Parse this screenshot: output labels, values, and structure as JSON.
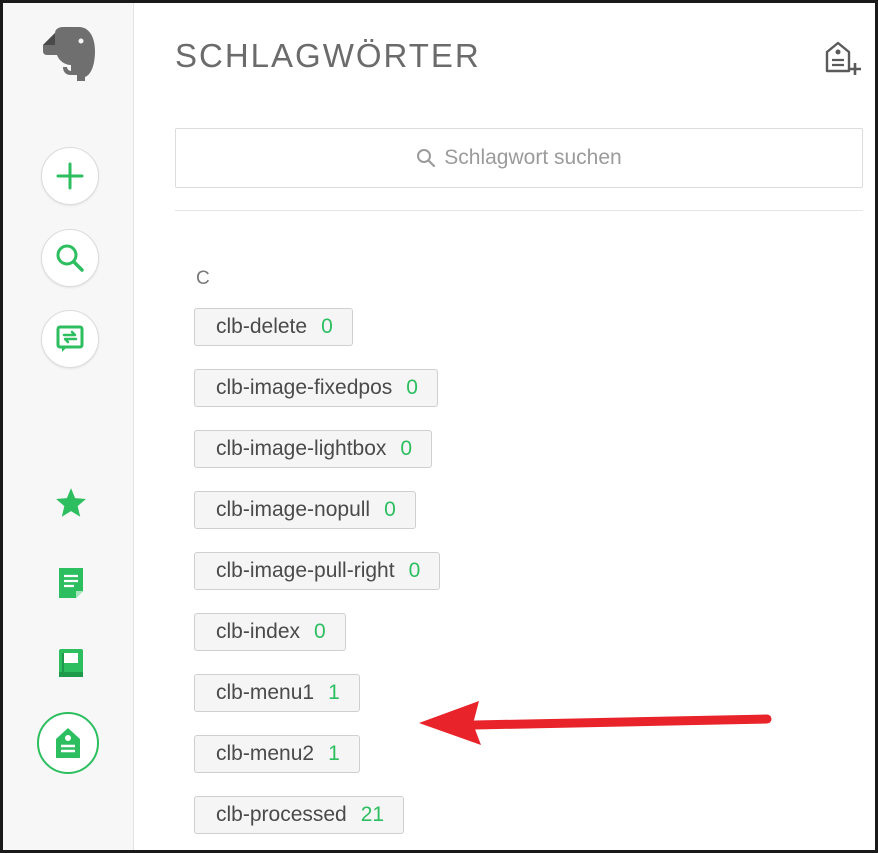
{
  "page": {
    "title": "SCHLAGWÖRTER"
  },
  "search": {
    "placeholder": "Schlagwort suchen"
  },
  "tags": {
    "section_letter": "C",
    "items": [
      {
        "name": "clb-delete",
        "count": "0"
      },
      {
        "name": "clb-image-fixedpos",
        "count": "0"
      },
      {
        "name": "clb-image-lightbox",
        "count": "0"
      },
      {
        "name": "clb-image-nopull",
        "count": "0"
      },
      {
        "name": "clb-image-pull-right",
        "count": "0"
      },
      {
        "name": "clb-index",
        "count": "0"
      },
      {
        "name": "clb-menu1",
        "count": "1"
      },
      {
        "name": "clb-menu2",
        "count": "1"
      },
      {
        "name": "clb-processed",
        "count": "21"
      }
    ]
  },
  "colors": {
    "accent": "#2dbe60",
    "annotation_arrow": "#e8232a"
  },
  "icons": [
    "evernote-elephant-icon",
    "new-note-icon",
    "search-icon",
    "work-chat-icon",
    "shortcuts-star-icon",
    "notes-icon",
    "notebooks-icon",
    "tags-icon",
    "add-tag-icon"
  ]
}
